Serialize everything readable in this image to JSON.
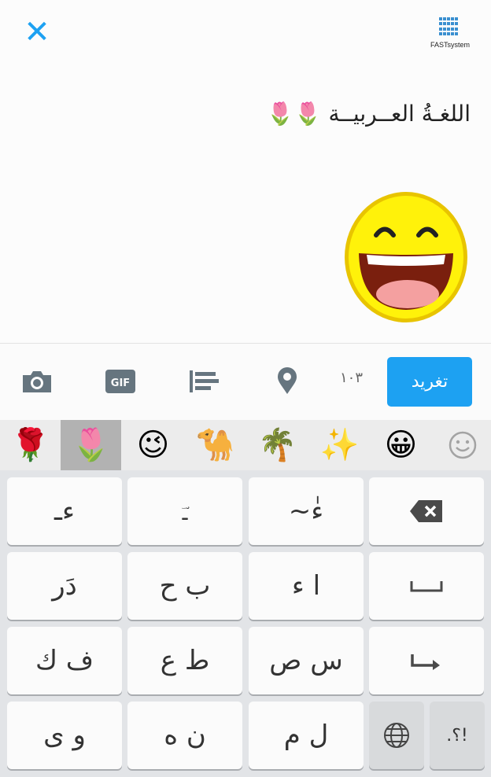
{
  "header": {
    "close_glyph": "✕",
    "logo_text": "FASTsystem"
  },
  "compose": {
    "text": "اللغـةُ العــربيــة 🌷🌷"
  },
  "toolbar": {
    "counter": "١٠٣",
    "tweet_label": "تغريد"
  },
  "emoji_bar": {
    "items": [
      "🌹",
      "🌷",
      "😉",
      "🐪",
      "🌴",
      "✨",
      "😀"
    ]
  },
  "keyboard": {
    "row1": [
      "ءـ",
      "ـؔ",
      "ءٰ~",
      "⌫"
    ],
    "row2": [
      "دَر",
      "ب ح",
      "ا ء",
      "⎵"
    ],
    "row3": [
      "ف ك",
      "ط ع",
      "س ص",
      "↵"
    ],
    "row4": [
      "و ى",
      "ن ه",
      "ل م",
      "🌐",
      "!؟."
    ]
  },
  "colors": {
    "accent": "#1da1f2"
  }
}
